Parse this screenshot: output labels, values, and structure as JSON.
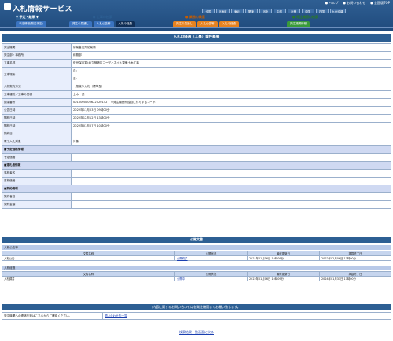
{
  "header": {
    "logo": "入札情報サービス",
    "toplinks": [
      "● ヘルプ",
      "● お問い合わせ",
      "● 全国版TOP"
    ],
    "regions": [
      "全国",
      "北海道",
      "東北",
      "関東",
      "北陸",
      "中部",
      "近畿",
      "中国",
      "四国",
      "九州沖縄"
    ]
  },
  "sections": {
    "left": "▼ 予定・結果 ▼",
    "center": "● 工事の検索",
    "right": "● 業務の検索",
    "far": "● 発注機関の検索"
  },
  "tabs": {
    "left": [
      "予定情報(発注予定)"
    ],
    "center": [
      "発注の見通し",
      "入札公告等",
      "入札の経過"
    ],
    "right": [
      "発注の見通し",
      "入札公告等",
      "入札の経過"
    ],
    "far": [
      "発注機関情報"
    ]
  },
  "panel_title": "入札の経過（工事）案件概要",
  "rows": [
    {
      "k": "発注機関",
      "v": "防衛省九州防衛局"
    },
    {
      "k": "発注部・事務所",
      "v": "総務部"
    },
    {
      "k": "工事名称",
      "v": "佐世保米軍(4)立神港区コーディネイト整備土木工事"
    },
    {
      "k": "工事場所",
      "v": "自："
    },
    {
      "k": "",
      "v": "至："
    },
    {
      "k": "入札契約方式",
      "v": "一般競争入札（標準型）"
    },
    {
      "k": "工事種別／工事の業種",
      "v": "土木一式"
    },
    {
      "k": "調達番号",
      "v": "0010000000622520152",
      "note": "※発注機関が独自に付与するコード"
    },
    {
      "k": "公告日時",
      "v": "2022年11月03日 09時00分"
    },
    {
      "k": "開札日時",
      "v": "2022年12月12日 13時00分"
    },
    {
      "k": "開札日時",
      "v": "2022年01月07日 10時00分"
    },
    {
      "k": "契約日",
      "v": ""
    },
    {
      "k": "電子入札対象",
      "v": "対象"
    }
  ],
  "predict_head": "予定価格情報",
  "predict_rows": [
    {
      "k": "予定価格",
      "v": ""
    }
  ],
  "winner_head": "落札者情報",
  "winner_rows": [
    {
      "k": "落札者名",
      "v": ""
    },
    {
      "k": "落札価格",
      "v": ""
    }
  ],
  "contract_head": "契約情報",
  "contract_rows": [
    {
      "k": "契約者名",
      "v": ""
    },
    {
      "k": "契約金額",
      "v": ""
    }
  ],
  "public_docs_title": "公開文書",
  "doc_groups": [
    {
      "name": "入札公告等",
      "header": [
        "文書名称",
        "公開状況",
        "最終更新日",
        "掲載終了日"
      ],
      "rows": [
        [
          "入札公告",
          "公開終了",
          "2021年01月16日 10時09分",
          "2022年02月06日 17時00分"
        ]
      ]
    },
    {
      "name": "入札経過",
      "header": [
        "文書名称",
        "公開状況",
        "最終更新日",
        "掲載終了日"
      ],
      "rows": [
        [
          "入札調書",
          "公開中",
          "2022年01月06日 10時09分",
          "2024年01月31日 17時00分"
        ]
      ]
    }
  ],
  "contact_title": "内容に関するお問い合わせは各発注機関までお願い致します。",
  "contact": {
    "label": "発注機関への連絡先等はこちらからご確認ください。",
    "link": "問い合わせ先一覧"
  },
  "back_link": "検索結果一覧画面に戻る"
}
